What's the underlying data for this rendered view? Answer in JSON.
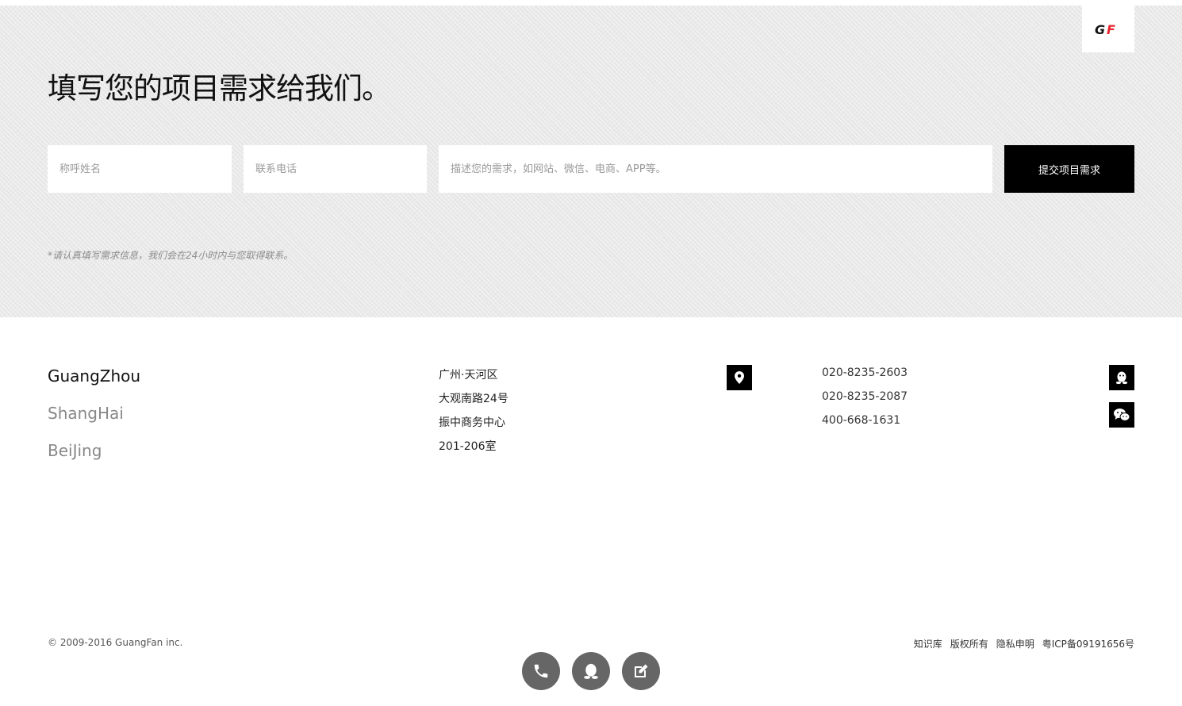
{
  "logo": {
    "text": "GF",
    "brand_color": "#e8262e"
  },
  "contact_form": {
    "headline": "填写您的项目需求给我们。",
    "name_placeholder": "称呼姓名",
    "phone_placeholder": "联系电话",
    "desc_placeholder": "描述您的需求，如网站、微信、电商、APP等。",
    "submit_label": "提交项目需求",
    "notice": "*请认真填写需求信息，我们会在24小时内与您取得联系。"
  },
  "offices": {
    "cities": [
      {
        "name": "GuangZhou",
        "active": true
      },
      {
        "name": "ShangHai",
        "active": false
      },
      {
        "name": "BeiJing",
        "active": false
      }
    ],
    "address_lines": [
      "广州·天河区",
      "大观南路24号",
      "振中商务中心",
      "201-206室"
    ],
    "phones": [
      "020-8235-2603",
      "020-8235-2087",
      "400-668-1631"
    ],
    "icons": {
      "location": "location-pin-icon",
      "qq": "qq-icon",
      "wechat": "wechat-icon"
    }
  },
  "footer": {
    "copyright": "© 2009-2016 GuangFan inc.",
    "links": [
      "知识库",
      "版权所有",
      "隐私申明",
      "粤ICP备09191656号"
    ],
    "float_buttons": [
      "phone-icon",
      "qq-icon",
      "edit-icon"
    ]
  },
  "colors": {
    "accent": "#000000",
    "brand_red": "#e8262e",
    "section_bg": "#e9e9e9",
    "float_button": "#666666"
  }
}
